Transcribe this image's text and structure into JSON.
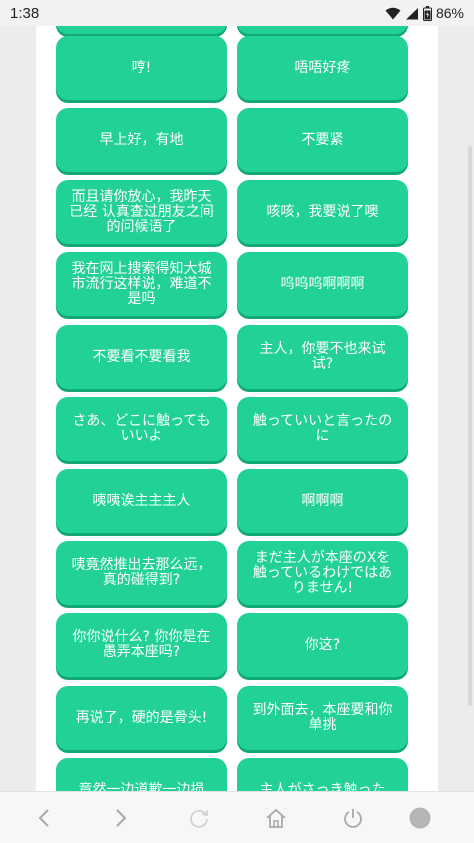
{
  "status_bar": {
    "time": "1:38",
    "battery": "86%",
    "icons": [
      "wifi-icon",
      "signal-icon",
      "battery-icon"
    ]
  },
  "buttons": [
    {
      "label": ""
    },
    {
      "label": ""
    },
    {
      "label": "哼!"
    },
    {
      "label": "唔唔好疼"
    },
    {
      "label": "早上好，有地"
    },
    {
      "label": "不要紧"
    },
    {
      "label": "而且请你放心，我昨天已经 认真查过朋友之间的问候语了"
    },
    {
      "label": "咳咳，我要说了噢"
    },
    {
      "label": "我在网上搜索得知大城市流行这样说，难道不是吗"
    },
    {
      "label": "呜呜呜啊啊啊"
    },
    {
      "label": "不要看不要看我"
    },
    {
      "label": "主人，你要不也来试试?"
    },
    {
      "label": "さあ、どこに触ってもいいよ"
    },
    {
      "label": "触っていいと言ったのに"
    },
    {
      "label": "咦咦诶主主主人"
    },
    {
      "label": "啊啊啊"
    },
    {
      "label": "咦竟然推出去那么远，真的碰得到?"
    },
    {
      "label": "まだ主人が本座のXを触っているわけではありません!"
    },
    {
      "label": "你你说什么? 你你是在愚弄本座吗?"
    },
    {
      "label": "你这?"
    },
    {
      "label": "再说了，硬的是骨头!"
    },
    {
      "label": "到外面去，本座要和你单挑"
    },
    {
      "label": "竟然一边道歉一边损"
    },
    {
      "label": "主人がさっき触った"
    }
  ],
  "nav": {
    "icons": [
      "back-icon",
      "forward-icon",
      "refresh-icon",
      "home-icon",
      "power-icon",
      "record-icon"
    ]
  },
  "colors": {
    "button_bg": "#22d197",
    "button_shadow": "#12a877",
    "button_text": "#ffffff",
    "page_bg": "#ececec",
    "card_bg": "#ffffff"
  }
}
